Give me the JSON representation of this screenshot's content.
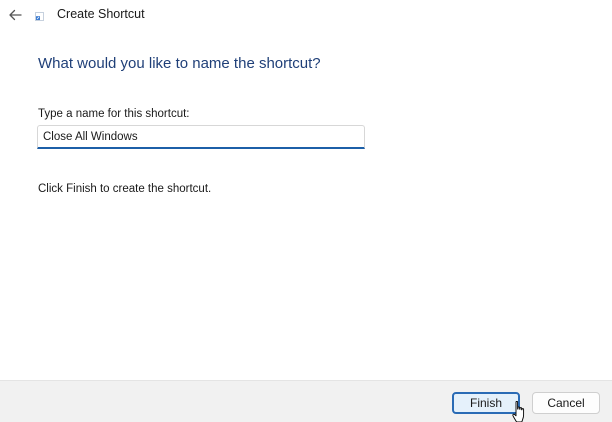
{
  "window": {
    "title": "Create Shortcut"
  },
  "titlebar": {
    "back_icon": "arrow-left-icon",
    "app_icon": "shortcut-app-icon"
  },
  "main": {
    "heading": "What would you like to name the shortcut?",
    "name_label": "Type a name for this shortcut:",
    "name_value": "Close All Windows",
    "instruction": "Click Finish to create the shortcut."
  },
  "footer": {
    "finish_label": "Finish",
    "cancel_label": "Cancel"
  },
  "colors": {
    "heading": "#1f3f78",
    "input_underline": "#1c5fa8",
    "default_button_border": "#2a6bb5",
    "footer_background": "#f1f1f1"
  }
}
